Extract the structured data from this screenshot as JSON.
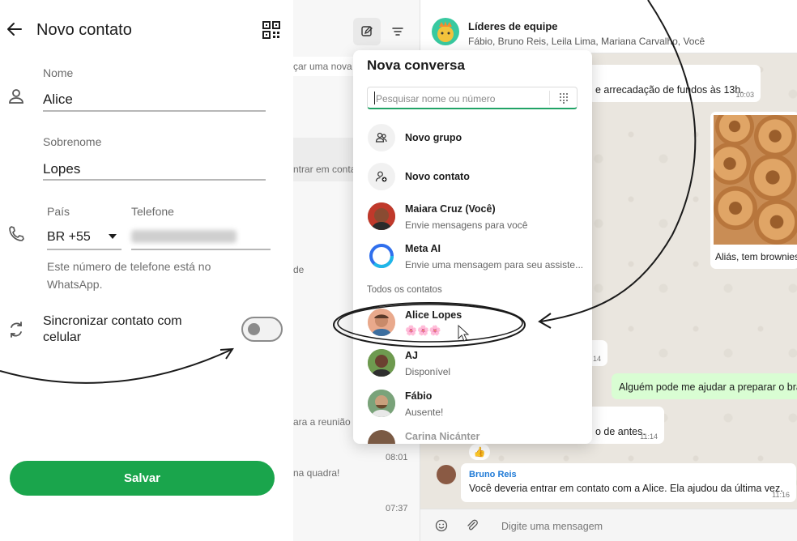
{
  "phone_form": {
    "title": "Novo contato",
    "first_name_label": "Nome",
    "first_name_value": "Alice",
    "last_name_label": "Sobrenome",
    "last_name_value": "Lopes",
    "country_label": "País",
    "country_value": "BR +55",
    "phone_label": "Telefone",
    "helper_text": "Este número de telefone está no WhatsApp.",
    "sync_label": "Sincronizar contato com celular",
    "sync_on": false,
    "save_label": "Salvar",
    "colors": {
      "accent": "#1aa54c"
    }
  },
  "chat_list": {
    "search_placeholder_fragment": "çar uma nova",
    "previews": [
      {
        "text": "ntrar em conta"
      },
      {
        "text": "de"
      },
      {
        "text": "ara a reunião",
        "time": "08:01"
      },
      {
        "text": "na quadra!",
        "time": "07:37"
      }
    ]
  },
  "conversation": {
    "group_name": "Líderes de equipe",
    "members": "Fábio, Bruno Reis, Leila Lima, Mariana Carvalho, Você",
    "messages": [
      {
        "text": "e arrecadação de fundos às 13h.",
        "time": "10:03"
      },
      {
        "caption": "Aliás, tem brownies"
      },
      {
        "time": "14"
      },
      {
        "text": "Alguém pode me ajudar a preparar o bra"
      },
      {
        "text": "o de antes.",
        "time": "11:14"
      },
      {
        "reaction": "👍"
      },
      {
        "sender": "Bruno Reis",
        "text": "Você deveria entrar em contato com a Alice. Ela ajudou da última vez.",
        "time": "11:16"
      }
    ],
    "composer_placeholder": "Digite uma mensagem"
  },
  "new_chat_popup": {
    "title": "Nova conversa",
    "search_placeholder": "Pesquisar nome ou número",
    "actions": [
      {
        "label": "Novo grupo",
        "icon": "group-icon"
      },
      {
        "label": "Novo contato",
        "icon": "add-contact-icon"
      }
    ],
    "pinned": [
      {
        "name": "Maiara Cruz (Você)",
        "status": "Envie mensagens para você"
      },
      {
        "name": "Meta AI",
        "status": "Envie uma mensagem para seu assiste..."
      }
    ],
    "section_label": "Todos os contatos",
    "contacts": [
      {
        "name": "Alice Lopes",
        "status": "🌸🌸🌸"
      },
      {
        "name": "AJ",
        "status": "Disponível"
      },
      {
        "name": "Fábio",
        "status": "Ausente!"
      },
      {
        "name": "Carina Nicánter",
        "status": ""
      }
    ]
  }
}
